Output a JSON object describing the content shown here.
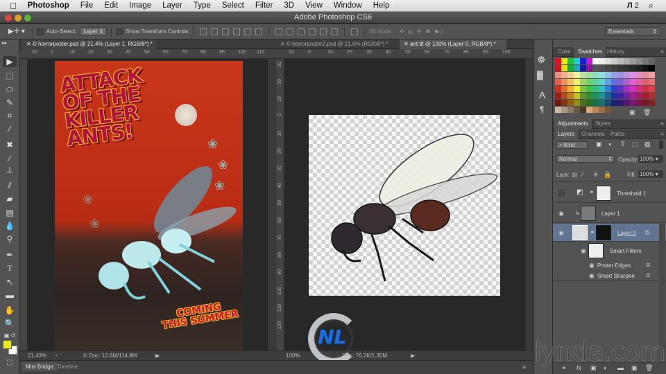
{
  "menubar": {
    "apple_icon": "apple-icon",
    "app_name": "Photoshop",
    "items": [
      "File",
      "Edit",
      "Image",
      "Layer",
      "Type",
      "Select",
      "Filter",
      "3D",
      "View",
      "Window",
      "Help"
    ],
    "adobe_badge": "2"
  },
  "window": {
    "title": "Adobe Photoshop CS6"
  },
  "options_bar": {
    "auto_select_label": "Auto-Select:",
    "auto_select_value": "Layer",
    "show_transform_label": "Show Transform Controls",
    "mode_3d_label": "3D Mode:",
    "workspace": "Essentials"
  },
  "documents": {
    "left": {
      "tab": "horrorposter.psd @ 21.4% (Layer 1, RGB/8*) *",
      "ruler_labels": [
        "20",
        "0",
        "10",
        "20",
        "30",
        "40",
        "50",
        "60",
        "70",
        "80",
        "90",
        "100",
        "110"
      ],
      "zoom": "21.43%",
      "doc_info": "Doc: 12.6M/114.8M"
    },
    "right": {
      "tabs": [
        "horrorposter2.psd @ 21.6% (RGB/8*) *",
        "ant.tif @ 100% (Layer 0, RGB/8*) *"
      ],
      "active_tab": 1,
      "ruler_labels": [
        "10",
        "0",
        "10",
        "20",
        "30",
        "40",
        "50",
        "60",
        "70",
        "80",
        "90",
        "100"
      ],
      "vruler_labels": [
        "30",
        "20",
        "10",
        "0",
        "10",
        "20",
        "30",
        "40",
        "50",
        "60",
        "70",
        "80",
        "90",
        "100",
        "110",
        "120"
      ],
      "zoom": "100%",
      "doc_info": "Doc: 76.2K/1.35M"
    }
  },
  "poster": {
    "title_lines": [
      "ATTACK",
      "OF THE",
      "KILLER",
      "ANTS!"
    ],
    "tagline_lines": [
      "COMING",
      "THIS SUMMER"
    ]
  },
  "bottom_tabs": [
    "Mini Bridge",
    "Timeline"
  ],
  "colors": {
    "foreground": "#e8ec12",
    "background": "#ffffff",
    "accent_selected_layer": "#5f7591"
  },
  "panels": {
    "color_tabs": [
      "Color",
      "Swatches",
      "History"
    ],
    "color_active": 1,
    "adjust_tabs": [
      "Adjustments",
      "Styles"
    ],
    "layers_tabs": [
      "Layers",
      "Channels",
      "Paths"
    ],
    "kind_filter": "Kind",
    "blend_mode": "Normal",
    "opacity_label": "Opacity:",
    "opacity_value": "100%",
    "lock_label": "Lock:",
    "fill_label": "Fill:",
    "fill_value": "100%",
    "layers": [
      {
        "name": "Threshold 1",
        "visible": false
      },
      {
        "name": "Layer 1",
        "visible": true
      },
      {
        "name": "Layer 0",
        "visible": true,
        "selected": true
      }
    ],
    "smart_filters_label": "Smart Filters",
    "smart_filters": [
      "Poster Edges",
      "Smart Sharpen"
    ]
  },
  "watermark": {
    "text": "lynda.com"
  },
  "overlay_logo": "NL"
}
